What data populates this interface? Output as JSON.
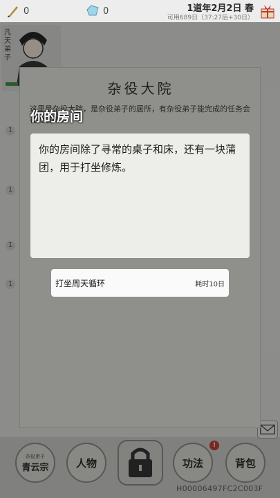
{
  "topbar": {
    "resource1_value": "0",
    "resource2_value": "0",
    "date": "1道年2月2日 春",
    "date_sub": "可用689日（37:27后+30日）"
  },
  "portrait": {
    "vertical_text": "凡天弟子"
  },
  "panel": {
    "title": "杂役大院",
    "description": "这里是杂役大院，是杂役弟子的居所，有杂役弟子能完成的任务会在此发布。"
  },
  "room": {
    "title": "你的房间",
    "text": "你的房间除了寻常的桌子和床，还有一块蒲团，用于打坐修炼。"
  },
  "option": {
    "name": "打坐周天循环",
    "time": "耗时10日"
  },
  "nav": {
    "sect_small": "杂役弟子",
    "sect": "青云宗",
    "character": "人物",
    "skills": "功法",
    "skills_badge": "!",
    "bag": "背包"
  },
  "device_id": "H00006497FC2C003F",
  "colors": {
    "overlay": "#2a2a2a",
    "panel": "#8f8f8c",
    "popup_box": "#ededea",
    "badge": "#c0392b"
  },
  "icons": [
    "brush-icon",
    "crystal-icon",
    "gift-icon",
    "lock-icon",
    "mail-icon"
  ]
}
